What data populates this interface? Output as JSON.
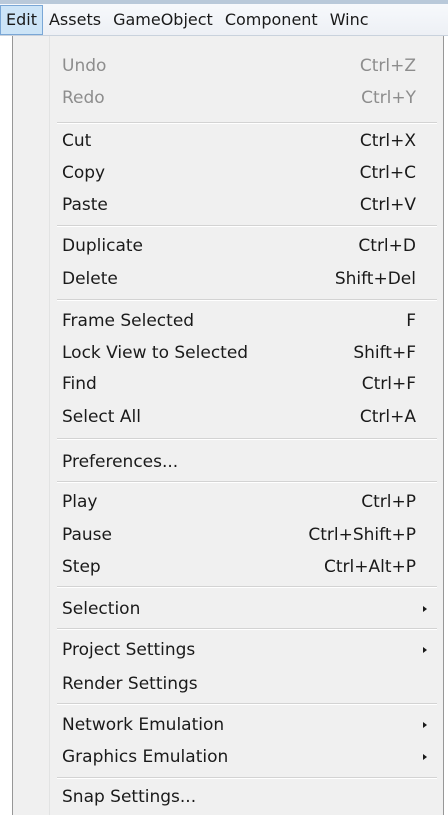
{
  "menubar": {
    "items": [
      {
        "label": "Edit",
        "active": true
      },
      {
        "label": "Assets"
      },
      {
        "label": "GameObject"
      },
      {
        "label": "Component"
      },
      {
        "label": "Winc"
      }
    ]
  },
  "edit_menu": {
    "items": [
      {
        "label": "Undo",
        "shortcut": "Ctrl+Z",
        "disabled": true
      },
      {
        "label": "Redo",
        "shortcut": "Ctrl+Y",
        "disabled": true
      },
      {
        "label": "Cut",
        "shortcut": "Ctrl+X"
      },
      {
        "label": "Copy",
        "shortcut": "Ctrl+C"
      },
      {
        "label": "Paste",
        "shortcut": "Ctrl+V"
      },
      {
        "label": "Duplicate",
        "shortcut": "Ctrl+D"
      },
      {
        "label": "Delete",
        "shortcut": "Shift+Del"
      },
      {
        "label": "Frame Selected",
        "shortcut": "F"
      },
      {
        "label": "Lock View to Selected",
        "shortcut": "Shift+F"
      },
      {
        "label": "Find",
        "shortcut": "Ctrl+F"
      },
      {
        "label": "Select All",
        "shortcut": "Ctrl+A"
      },
      {
        "label": "Preferences..."
      },
      {
        "label": "Play",
        "shortcut": "Ctrl+P"
      },
      {
        "label": "Pause",
        "shortcut": "Ctrl+Shift+P"
      },
      {
        "label": "Step",
        "shortcut": "Ctrl+Alt+P"
      },
      {
        "label": "Selection",
        "submenu": true,
        "icon": "submenu-arrow-icon"
      },
      {
        "label": "Project Settings",
        "submenu": true,
        "icon": "submenu-arrow-icon"
      },
      {
        "label": "Render Settings"
      },
      {
        "label": "Network Emulation",
        "submenu": true,
        "icon": "submenu-arrow-icon"
      },
      {
        "label": "Graphics Emulation",
        "submenu": true,
        "icon": "submenu-arrow-icon"
      },
      {
        "label": "Snap Settings..."
      }
    ]
  },
  "colors": {
    "menu_background": "#f0f0f0",
    "active_menubar_item": "#cce4f7",
    "disabled_text": "#8d8d8d"
  }
}
